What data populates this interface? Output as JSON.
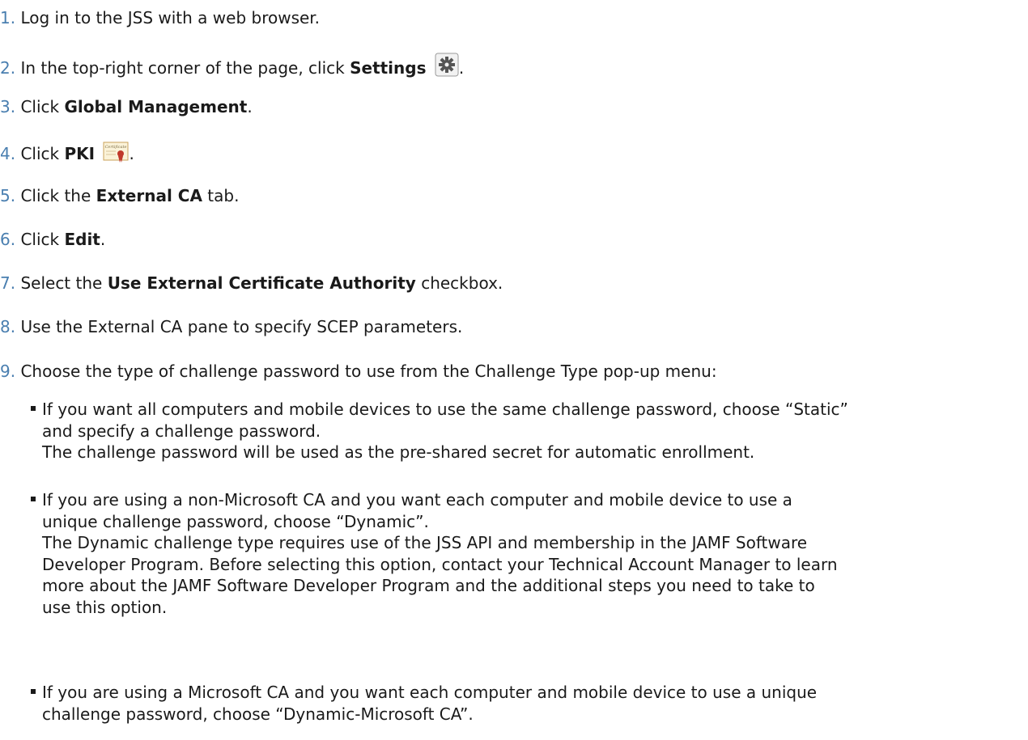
{
  "steps": [
    {
      "num": "1.",
      "pre": "Log in to the JSS with a web browser."
    },
    {
      "num": "2.",
      "pre": "In the top-right corner of the page, click ",
      "bold": "Settings",
      "post": "."
    },
    {
      "num": "3.",
      "pre": "Click ",
      "bold": "Global Management",
      "post": "."
    },
    {
      "num": "4.",
      "pre": "Click ",
      "bold": "PKI",
      "post": "."
    },
    {
      "num": "5.",
      "pre": "Click the ",
      "bold": "External CA",
      "post": " tab."
    },
    {
      "num": "6.",
      "pre": "Click ",
      "bold": "Edit",
      "post": "."
    },
    {
      "num": "7.",
      "pre": "Select the ",
      "bold": "Use External Certificate Authority",
      "post": " checkbox."
    },
    {
      "num": "8.",
      "pre": "Use the External CA pane to specify SCEP parameters."
    },
    {
      "num": "9.",
      "pre": "Choose the type of challenge password to use from the Challenge Type pop-up menu:"
    }
  ],
  "icons": {
    "settings": "gear-icon",
    "pki": "certificate-icon",
    "certificate_text": "Certificate"
  },
  "bullets": [
    {
      "lines": [
        "If you want all computers and mobile devices to use the same challenge password, choose “Static”",
        "and specify a challenge password.",
        "The challenge password will be used as the pre-shared secret for automatic enrollment."
      ]
    },
    {
      "lines": [
        "If you are using a non-Microsoft CA and you want each computer and mobile device to use a",
        "unique challenge password, choose “Dynamic”.",
        "The Dynamic challenge type requires use of the JSS API and membership in the JAMF Software",
        "Developer Program. Before selecting this option, contact your Technical Account Manager to learn",
        "more about the JAMF Software Developer Program and the additional steps you need to take to",
        "use this option."
      ]
    },
    {
      "lines": [
        "If you are using a Microsoft CA and you want each computer and mobile device to use a unique",
        "challenge password, choose “Dynamic-Microsoft CA”."
      ]
    }
  ]
}
